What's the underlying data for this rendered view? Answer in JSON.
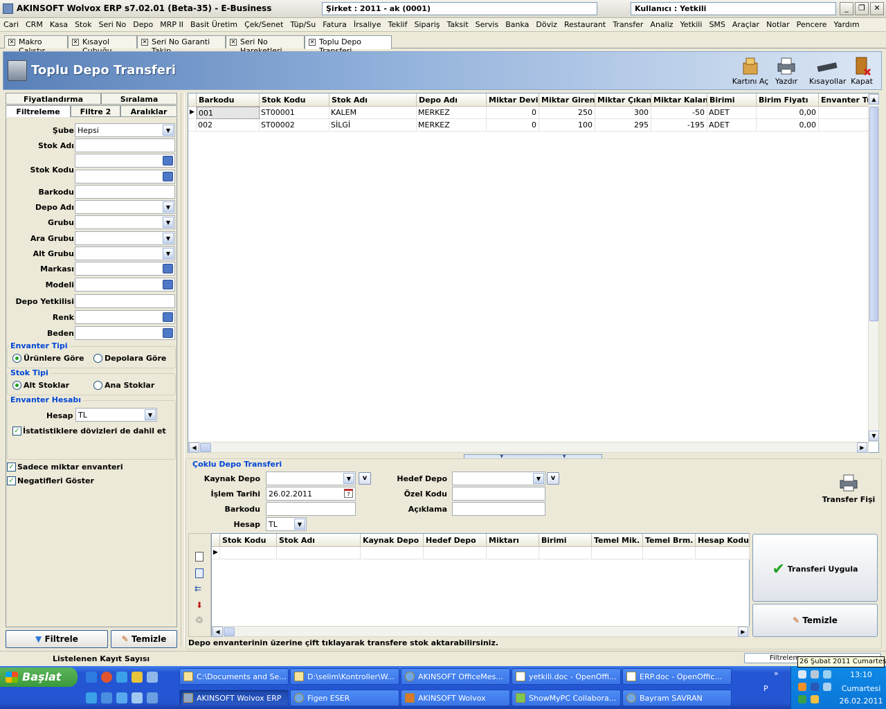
{
  "window": {
    "title": "AKINSOFT Wolvox ERP s7.02.01 (Beta-35) - E-Business",
    "company": "Şirket : 2011 - ak (0001)",
    "user": "Kullanıcı : Yetkili"
  },
  "menu": [
    "Cari",
    "CRM",
    "Kasa",
    "Stok",
    "Seri No",
    "Depo",
    "MRP II",
    "Basit Üretim",
    "Çek/Senet",
    "Tüp/Su",
    "Fatura",
    "İrsaliye",
    "Teklif",
    "Sipariş",
    "Taksit",
    "Servis",
    "Banka",
    "Döviz",
    "Restaurant",
    "Transfer",
    "Analiz",
    "Yetkili",
    "SMS",
    "Araçlar",
    "Notlar",
    "Pencere",
    "Yardım"
  ],
  "tabs": [
    "Makro Çalıştır",
    "Kısayol Çubuğu",
    "Seri No Garanti Takip",
    "Seri No Hareketleri",
    "Toplu Depo Transferi"
  ],
  "header": {
    "title": "Toplu Depo Transferi",
    "buttons": {
      "open_card": "Kartını Aç",
      "print": "Yazdır",
      "shortcuts": "Kısayollar",
      "close": "Kapat"
    }
  },
  "left": {
    "tabs": {
      "pricing": "Fiyatlandırma",
      "sorting": "Sıralama",
      "filtering": "Filtreleme",
      "filter2": "Filtre 2",
      "ranges": "Aralıklar"
    },
    "labels": {
      "sube": "Şube",
      "stok_adi": "Stok Adı",
      "stok_kodu": "Stok Kodu",
      "barkodu": "Barkodu",
      "depo_adi": "Depo Adı",
      "grubu": "Grubu",
      "ara_grubu": "Ara Grubu",
      "alt_grubu": "Alt Grubu",
      "markasi": "Markası",
      "modeli": "Modeli",
      "depo_yetkilisi": "Depo Yetkilisi",
      "renk": "Renk",
      "beden": "Beden"
    },
    "sube_value": "Hepsi",
    "envanter_tipi": {
      "title": "Envanter Tipi",
      "opt1": "Ürünlere Göre",
      "opt2": "Depolara Göre"
    },
    "stok_tipi": {
      "title": "Stok Tipi",
      "opt1": "Alt Stoklar",
      "opt2": "Ana Stoklar"
    },
    "envanter_hesabi": {
      "title": "Envanter Hesabı",
      "hesap_label": "Hesap",
      "hesap_value": "TL",
      "doviz_check": "İstatistiklere dövizleri de dahil et"
    },
    "checks": {
      "sadece_miktar": "Sadece miktar envanteri",
      "negatifleri": "Negatifleri Göster"
    },
    "buttons": {
      "filter": "Filtrele",
      "clear": "Temizle"
    }
  },
  "grid": {
    "columns": [
      "Barkodu",
      "Stok Kodu",
      "Stok Adı",
      "Depo Adı",
      "Miktar Devir",
      "Miktar Giren",
      "Miktar Çıkan",
      "Miktar Kalan",
      "Birimi",
      "Birim Fiyatı",
      "Envanter Tu"
    ],
    "rows": [
      [
        "001",
        "ST00001",
        "KALEM",
        "MERKEZ",
        "0",
        "250",
        "300",
        "-50",
        "ADET",
        "0,00",
        ""
      ],
      [
        "002",
        "ST00002",
        "SİLGİ",
        "MERKEZ",
        "0",
        "100",
        "295",
        "-195",
        "ADET",
        "0,00",
        ""
      ]
    ]
  },
  "transfer": {
    "section_title": "Çoklu Depo Transferi",
    "labels": {
      "kaynak_depo": "Kaynak Depo",
      "hedef_depo": "Hedef Depo",
      "islem_tarihi": "İşlem Tarihi",
      "ozel_kodu": "Özel Kodu",
      "barkodu": "Barkodu",
      "aciklama": "Açıklama",
      "hesap": "Hesap"
    },
    "values": {
      "islem_tarihi": "26.02.2011",
      "hesap": "TL"
    },
    "receipt_button": "Transfer Fişi",
    "columns": [
      "Stok Kodu",
      "Stok Adı",
      "Kaynak Depo",
      "Hedef Depo",
      "Miktarı",
      "Birimi",
      "Temel Mik.",
      "Temel Brm.",
      "Hesap Kodu"
    ],
    "apply_button": "Transferi Uygula",
    "clear_button": "Temizle",
    "hint": "Depo envanterinin üzerine çift tıklayarak transfere stok aktarabilirsiniz."
  },
  "status": {
    "record_count": "Listelenen Kayıt Sayısı",
    "filter_tab": "Filtrelem",
    "tooltip": "26 Şubat 2011 Cumartesi"
  },
  "taskbar": {
    "start": "Başlat",
    "row1": [
      "C:\\Documents and Se...",
      "D:\\selim\\Kontroller\\W...",
      "AKINSOFT OfficeMes...",
      "yetkili.doc - OpenOffi...",
      "ERP.doc - OpenOffic..."
    ],
    "row2": [
      "AKINSOFT Wolvox ERP",
      "Figen ESER",
      "AKINSOFT Wolvox",
      "ShowMyPC Collabora...",
      "Bayram SAVRAN"
    ],
    "lang": "P",
    "time": "13:10",
    "day": "Cumartesi",
    "date": "26.02.2011"
  }
}
